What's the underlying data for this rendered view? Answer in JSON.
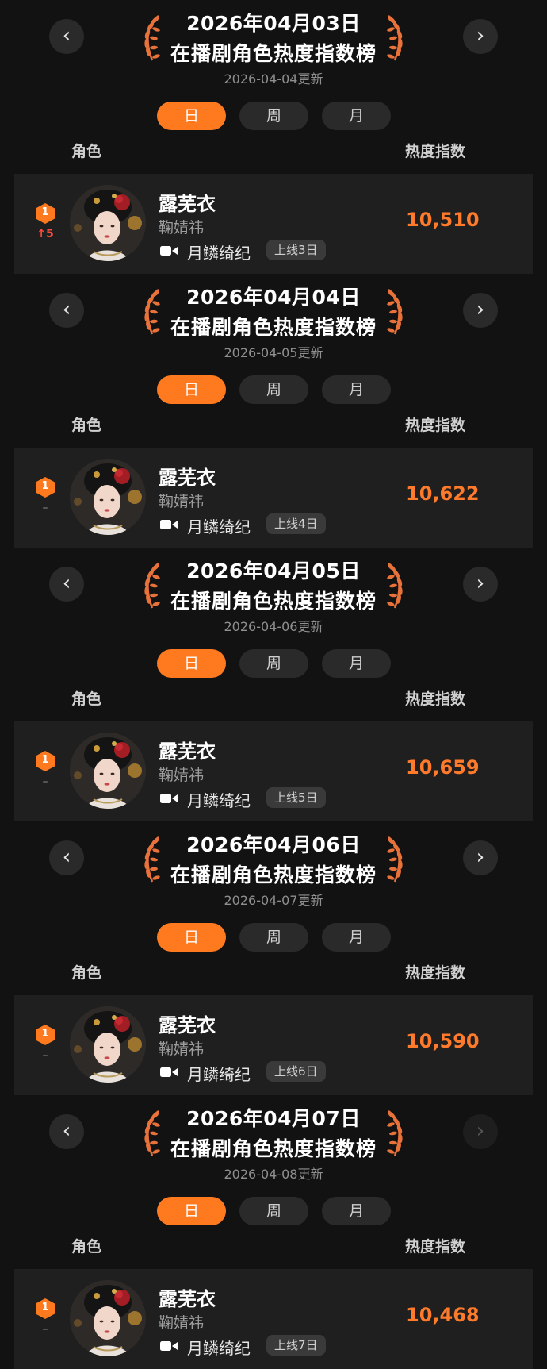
{
  "labels": {
    "role_header": "角色",
    "heat_header": "热度指数",
    "chart_title": "在播剧角色热度指数榜",
    "prev_icon": "chevron-left",
    "next_icon": "chevron-right",
    "tabs": [
      "日",
      "周",
      "月"
    ],
    "active_tab": "日"
  },
  "colors": {
    "accent": "#ff7a1f",
    "heat_value": "#ff7a2a",
    "rank_up": "#ff4a3d",
    "background": "#121212",
    "row_background": "#1f1f1f"
  },
  "sections": [
    {
      "date": "2026年04月03日",
      "updated": "2026-04-04更新",
      "entry": {
        "rank": "1",
        "rank_change": "↑5",
        "character": "露芜衣",
        "actor": "鞠婧祎",
        "drama": "月鳞绮纪",
        "online": "上线3日",
        "heat": "10,510"
      }
    },
    {
      "date": "2026年04月04日",
      "updated": "2026-04-05更新",
      "entry": {
        "rank": "1",
        "rank_change": "–",
        "character": "露芜衣",
        "actor": "鞠婧祎",
        "drama": "月鳞绮纪",
        "online": "上线4日",
        "heat": "10,622"
      }
    },
    {
      "date": "2026年04月05日",
      "updated": "2026-04-06更新",
      "entry": {
        "rank": "1",
        "rank_change": "–",
        "character": "露芜衣",
        "actor": "鞠婧祎",
        "drama": "月鳞绮纪",
        "online": "上线5日",
        "heat": "10,659"
      }
    },
    {
      "date": "2026年04月06日",
      "updated": "2026-04-07更新",
      "entry": {
        "rank": "1",
        "rank_change": "–",
        "character": "露芜衣",
        "actor": "鞠婧祎",
        "drama": "月鳞绮纪",
        "online": "上线6日",
        "heat": "10,590"
      }
    },
    {
      "date": "2026年04月07日",
      "updated": "2026-04-08更新",
      "entry": {
        "rank": "1",
        "rank_change": "–",
        "character": "露芜衣",
        "actor": "鞠婧祎",
        "drama": "月鳞绮纪",
        "online": "上线7日",
        "heat": "10,468"
      }
    }
  ]
}
